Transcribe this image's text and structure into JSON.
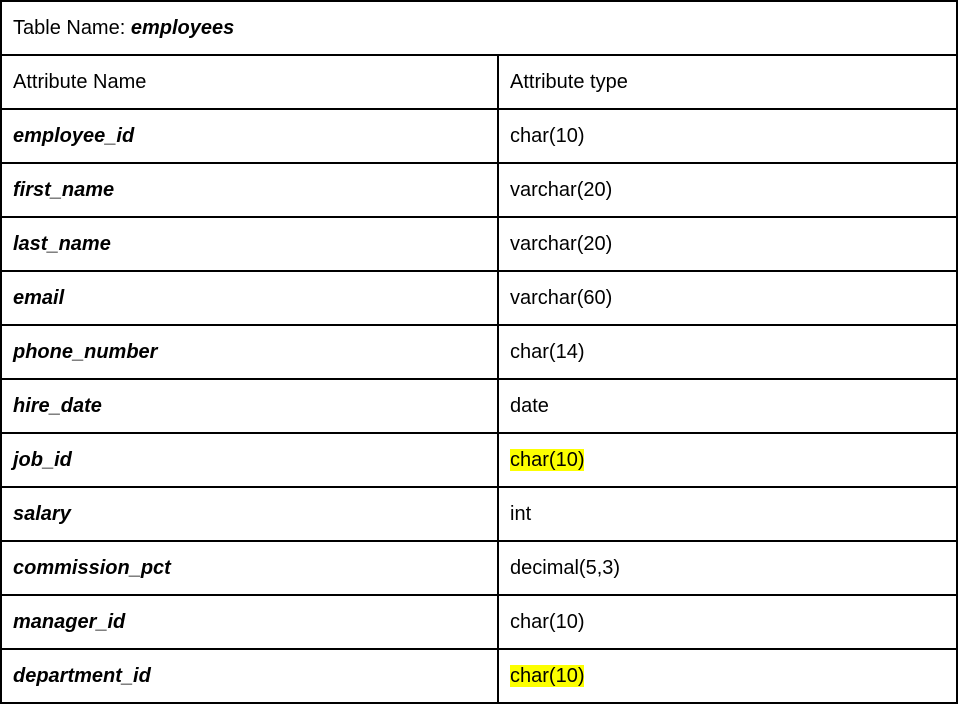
{
  "title_prefix": "Table Name: ",
  "title_name": "employees",
  "header": {
    "left": "Attribute Name",
    "right": "Attribute type"
  },
  "rows": [
    {
      "name": "employee_id",
      "type": "char(10)",
      "highlight": false
    },
    {
      "name": "first_name",
      "type": "varchar(20)",
      "highlight": false
    },
    {
      "name": "last_name",
      "type": "varchar(20)",
      "highlight": false
    },
    {
      "name": "email",
      "type": "varchar(60)",
      "highlight": false
    },
    {
      "name": "phone_number",
      "type": "char(14)",
      "highlight": false
    },
    {
      "name": "hire_date",
      "type": "date",
      "highlight": false
    },
    {
      "name": "job_id",
      "type": "char(10)",
      "highlight": true
    },
    {
      "name": "salary",
      "type": "int",
      "highlight": false
    },
    {
      "name": "commission_pct",
      "type": "decimal(5,3)",
      "highlight": false
    },
    {
      "name": "manager_id",
      "type": "char(10)",
      "highlight": false
    },
    {
      "name": "department_id",
      "type": "char(10)",
      "highlight": true
    }
  ]
}
